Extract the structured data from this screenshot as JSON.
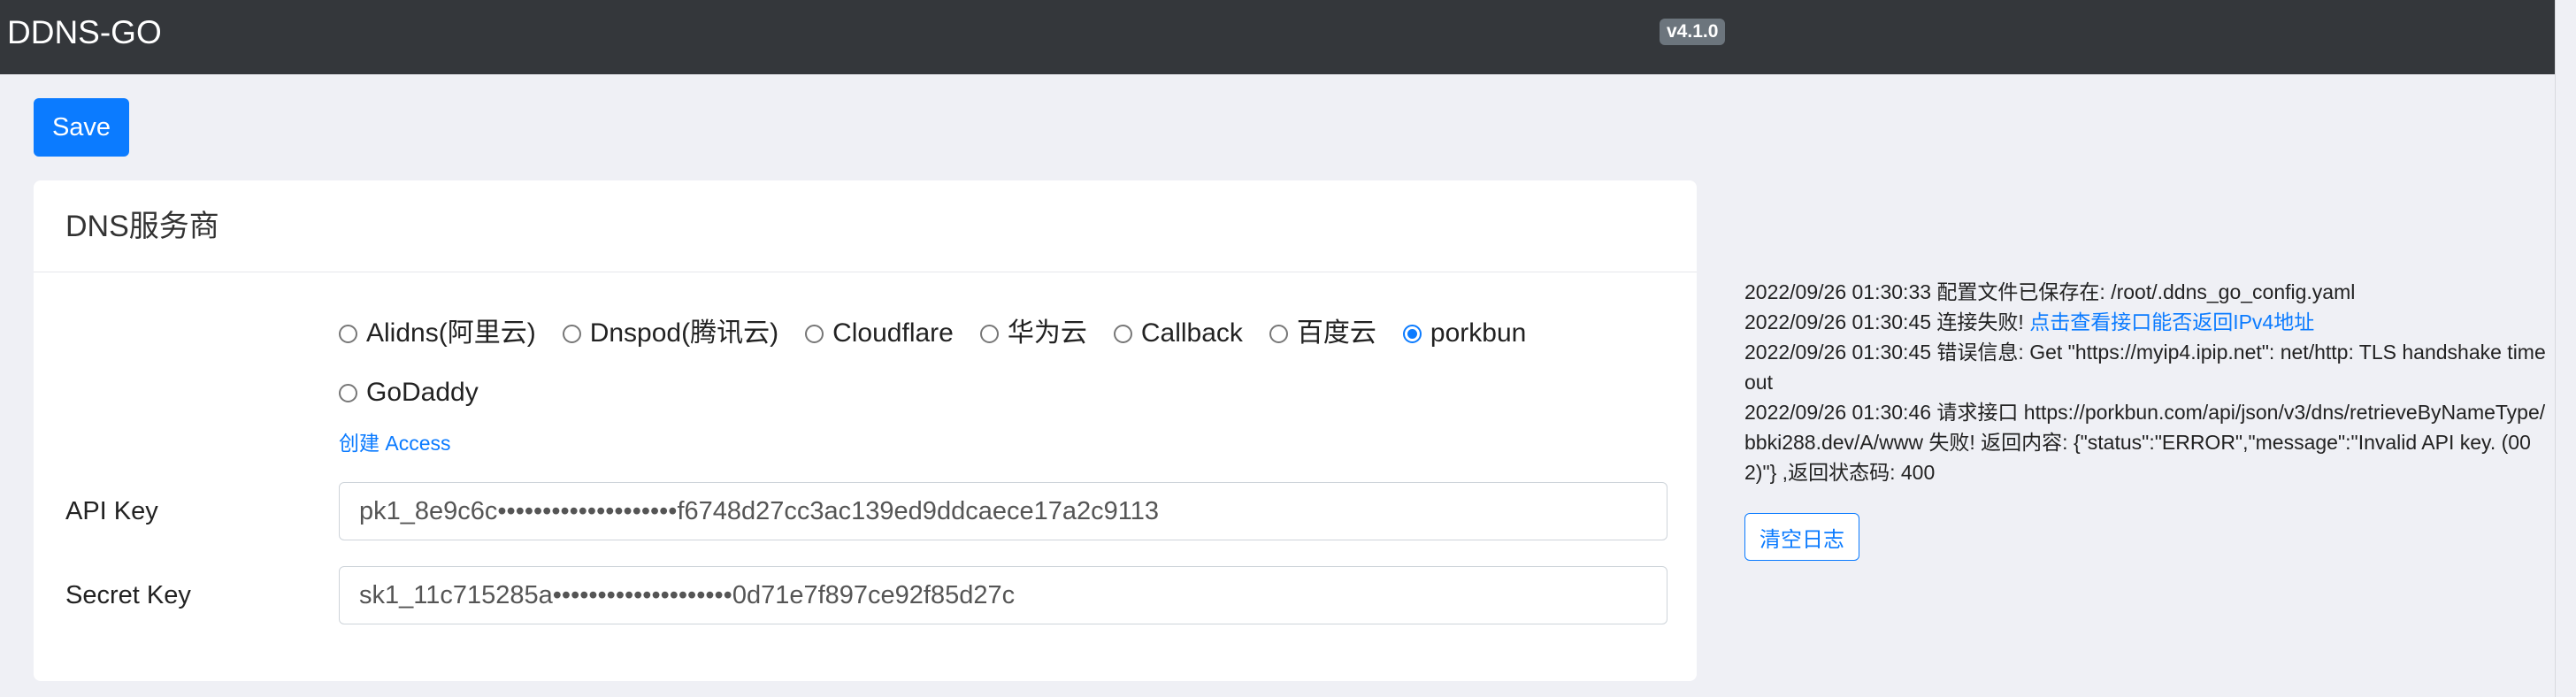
{
  "header": {
    "brand": "DDNS-GO",
    "version": "v4.1.0"
  },
  "toolbar": {
    "save_label": "Save"
  },
  "dns_card": {
    "title": "DNS服务商",
    "providers": [
      {
        "label": "Alidns(阿里云)",
        "checked": false
      },
      {
        "label": "Dnspod(腾讯云)",
        "checked": false
      },
      {
        "label": "Cloudflare",
        "checked": false
      },
      {
        "label": "华为云",
        "checked": false
      },
      {
        "label": "Callback",
        "checked": false
      },
      {
        "label": "百度云",
        "checked": false
      },
      {
        "label": "porkbun",
        "checked": true
      },
      {
        "label": "GoDaddy",
        "checked": false
      }
    ],
    "create_link": "创建 Access",
    "api_key_label": "API Key",
    "api_key_value": "pk1_8e9c6c••••••••••••••••••••f6748d27cc3ac139ed9ddcaece17a2c9113",
    "secret_key_label": "Secret Key",
    "secret_key_value": "sk1_11c715285a••••••••••••••••••••0d71e7f897ce92f85d27c"
  },
  "log": {
    "lines": [
      {
        "text": "2022/09/26 01:30:33 配置文件已保存在: /root/.ddns_go_config.yaml",
        "link": ""
      },
      {
        "text": "2022/09/26 01:30:45 连接失败! ",
        "link": "点击查看接口能否返回IPv4地址"
      },
      {
        "text": "2022/09/26 01:30:45 错误信息: Get \"https://myip4.ipip.net\": net/http: TLS handshake timeout",
        "link": ""
      },
      {
        "text": "2022/09/26 01:30:46 请求接口 https://porkbun.com/api/json/v3/dns/retrieveByNameType/bbki288.dev/A/www 失败! 返回内容: {\"status\":\"ERROR\",\"message\":\"Invalid API key. (002)\"} ,返回状态码: 400",
        "link": ""
      }
    ],
    "clear_label": "清空日志"
  }
}
